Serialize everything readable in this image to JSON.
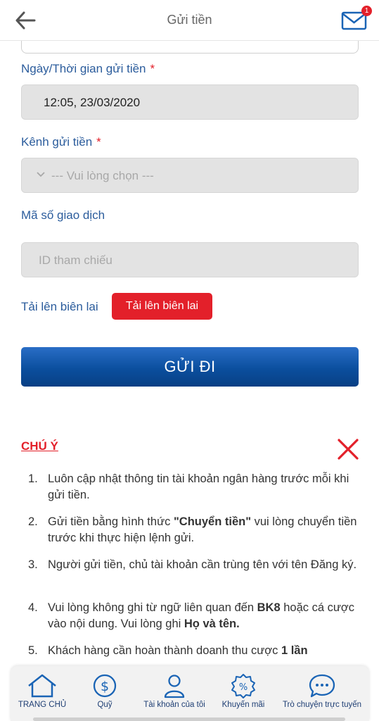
{
  "header": {
    "title": "Gửi tiền",
    "mail_badge": "1"
  },
  "form": {
    "datetime_label": "Ngày/Thời gian gửi tiền",
    "datetime_required": "*",
    "datetime_value": "12:05, 23/03/2020",
    "channel_label": "Kênh gửi tiền",
    "channel_required": "*",
    "channel_placeholder": "--- Vui lòng chọn ---",
    "txn_label": "Mã số giao dịch",
    "txn_placeholder": "ID tham chiếu",
    "receipt_label": "Tải lên biên lai",
    "receipt_button": "Tải lên biên lai",
    "submit_label": "GỬI ĐI"
  },
  "notes": {
    "title": "CHÚ Ý",
    "items": [
      {
        "num": "1.",
        "parts": [
          "Luôn cập nhật thông tin tài khoản ngân hàng trước mỗi khi gửi tiền."
        ]
      },
      {
        "num": "2.",
        "parts": [
          "Gửi tiền bằng hình thức ",
          "\"Chuyển tiền\"",
          " vui lòng chuyển tiền trước khi thực hiện lệnh gửi."
        ]
      },
      {
        "num": "3.",
        "parts": [
          "Người gửi tiền, chủ tài khoản cần trùng tên với tên Đăng ký."
        ]
      },
      {
        "num": "4.",
        "parts": [
          "Vui lòng không ghi từ ngữ liên quan đến ",
          "BK8",
          " hoặc cá cược vào nội dung. Vui lòng ghi ",
          "Họ và tên."
        ]
      },
      {
        "num": "5.",
        "parts": [
          "Khách hàng cần hoàn thành doanh thu cược ",
          "1 lần"
        ]
      }
    ]
  },
  "bottom_nav": [
    {
      "label": "TRANG CHỦ",
      "icon": "home-icon"
    },
    {
      "label": "Quỹ",
      "icon": "dollar-coin-icon"
    },
    {
      "label": "Tài khoản của tôi",
      "icon": "user-icon"
    },
    {
      "label": "Khuyến mãi",
      "icon": "percent-badge-icon"
    },
    {
      "label": "Trò chuyện trực tuyến",
      "icon": "chat-bubble-icon"
    }
  ],
  "colors": {
    "accent_red": "#e3202a",
    "label_blue": "#2b5c9c",
    "button_blue": "#0b4f9e",
    "nav_blue": "#1f3f74"
  }
}
